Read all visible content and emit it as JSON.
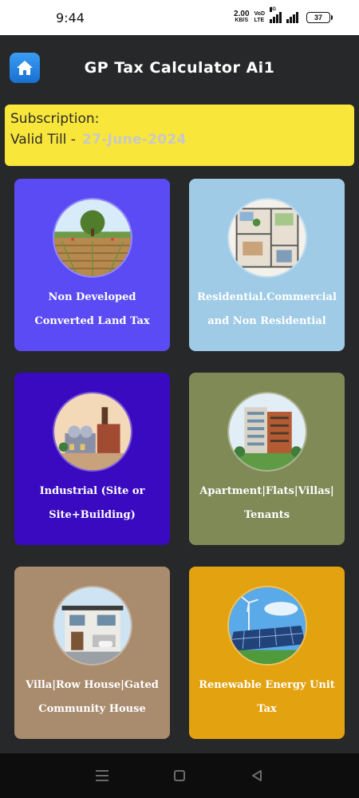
{
  "status_bar": {
    "time": "9:44",
    "net_speed_value": "2.00",
    "net_speed_unit": "KB/S",
    "volte_top": "VoD",
    "volte_bottom": "LTE",
    "network": "4G",
    "battery": "37"
  },
  "header": {
    "title": "GP Tax Calculator Ai1",
    "home_icon": "home-icon"
  },
  "subscription": {
    "title": "Subscription:",
    "valid_label": "Valid Till -",
    "valid_date": "27-June-2024"
  },
  "cards": [
    {
      "line1": "Non Developed",
      "line2": "Converted Land Tax",
      "color": "#5a4bf5"
    },
    {
      "line1": "Residential.Commercial",
      "line2": "and Non Residential",
      "color": "#9fcbe7"
    },
    {
      "line1": "Industrial (Site or",
      "line2": "Site+Building)",
      "color": "#3a0ac0"
    },
    {
      "line1": "Apartment|Flats|Villas|",
      "line2": "Tenants",
      "color": "#7f8a57"
    },
    {
      "line1": "Villa|Row House|Gated",
      "line2": "Community House",
      "color": "#a98b6e"
    },
    {
      "line1": "Renewable Energy Unit",
      "line2": "Tax",
      "color": "#e3a20f"
    }
  ],
  "nav": {
    "icons": [
      "menu-icon",
      "home-square-icon",
      "back-icon"
    ]
  }
}
